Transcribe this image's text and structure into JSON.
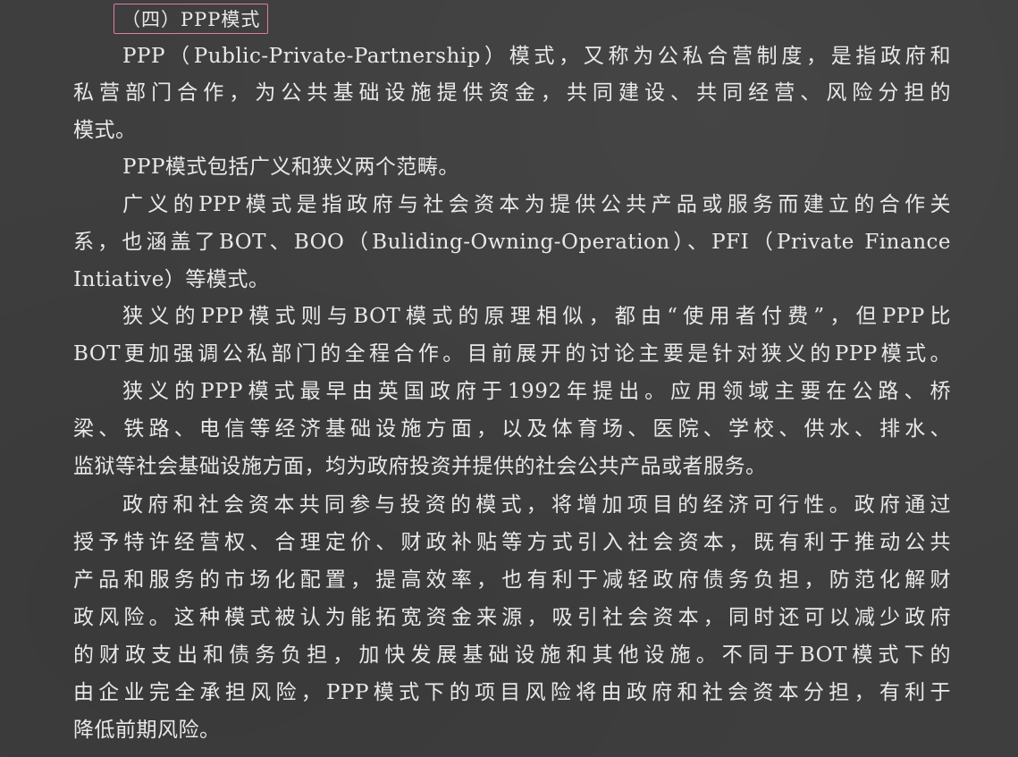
{
  "heading": "（四）PPP模式",
  "lines": [
    "PPP（Public-Private-Partnership）模式，又称为公私合营制度，是指政府和",
    "私营部门合作，为公共基础设施提供资金，共同建设、共同经营、风险分担的",
    "模式。",
    "PPP模式包括广义和狭义两个范畴。",
    "广义的PPP模式是指政府与社会资本为提供公共产品或服务而建立的合作关",
    "系，也涵盖了BOT、BOO（Buliding-Owning-Operation）、PFI（Private Finance",
    "Intiative）等模式。",
    "狭义的PPP模式则与BOT模式的原理相似，都由“使用者付费”，但PPP比",
    "BOT更加强调公私部门的全程合作。目前展开的讨论主要是针对狭义的PPP模式。",
    "狭义的PPP模式最早由英国政府于1992年提出。应用领域主要在公路、桥",
    "梁、铁路、电信等经济基础设施方面，以及体育场、医院、学校、供水、排水、",
    "监狱等社会基础设施方面，均为政府投资并提供的社会公共产品或者服务。",
    "政府和社会资本共同参与投资的模式，将增加项目的经济可行性。政府通过",
    "授予特许经营权、合理定价、财政补贴等方式引入社会资本，既有利于推动公共",
    "产品和服务的市场化配置，提高效率，也有利于减轻政府债务负担，防范化解财",
    "政风险。这种模式被认为能拓宽资金来源，吸引社会资本，同时还可以减少政府",
    "的财政支出和债务负担，加快发展基础设施和其他设施。不同于BOT模式下的",
    "由企业完全承担风险，PPP模式下的项目风险将由政府和社会资本分担，有利于",
    "降低前期风险。"
  ]
}
